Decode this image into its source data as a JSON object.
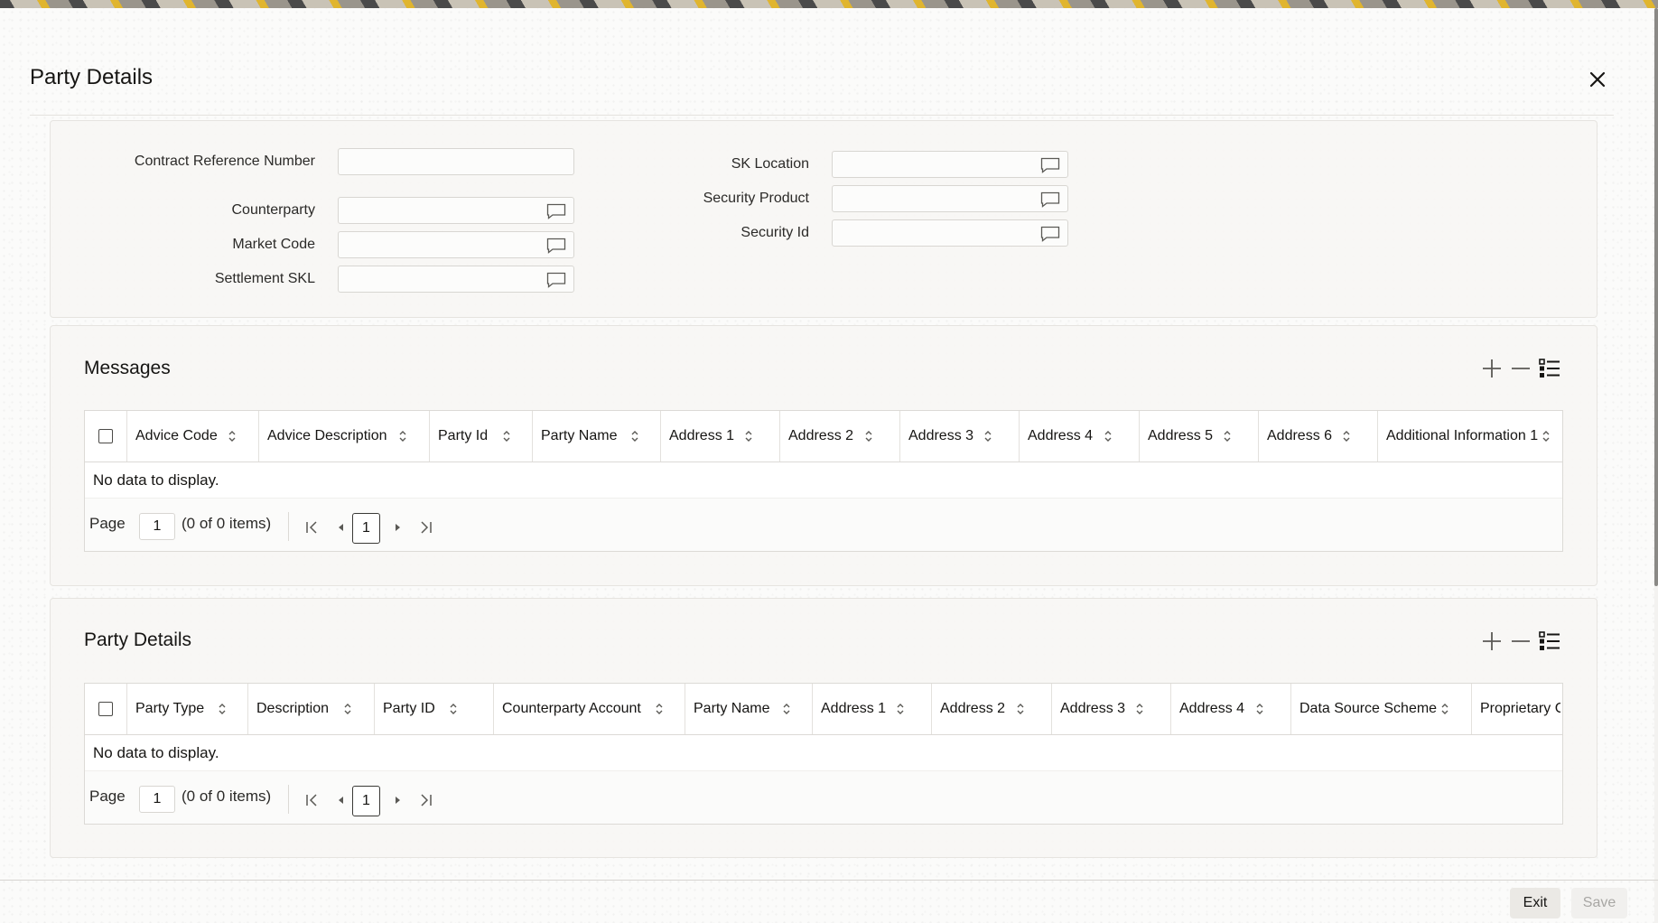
{
  "dialog": {
    "title": "Party Details"
  },
  "form": {
    "contract_reference_number": {
      "label": "Contract Reference Number",
      "value": ""
    },
    "counterparty": {
      "label": "Counterparty",
      "value": ""
    },
    "market_code": {
      "label": "Market Code",
      "value": ""
    },
    "settlement_skl": {
      "label": "Settlement SKL",
      "value": ""
    },
    "sk_location": {
      "label": "SK Location",
      "value": ""
    },
    "security_product": {
      "label": "Security Product",
      "value": ""
    },
    "security_id": {
      "label": "Security Id",
      "value": ""
    }
  },
  "messages": {
    "title": "Messages",
    "columns": [
      "Advice Code",
      "Advice Description",
      "Party Id",
      "Party Name",
      "Address 1",
      "Address 2",
      "Address 3",
      "Address 4",
      "Address 5",
      "Address 6",
      "Additional Information 1"
    ],
    "empty_text": "No data to display.",
    "pager": {
      "page_label": "Page",
      "page_value": "1",
      "items_text": "(0 of 0 items)",
      "current_page": "1"
    }
  },
  "party_details": {
    "title": "Party Details",
    "columns": [
      "Party Type",
      "Description",
      "Party ID",
      "Counterparty Account",
      "Party Name",
      "Address 1",
      "Address 2",
      "Address 3",
      "Address 4",
      "Data Source Scheme",
      "Proprietary C"
    ],
    "empty_text": "No data to display.",
    "pager": {
      "page_label": "Page",
      "page_value": "1",
      "items_text": "(0 of 0 items)",
      "current_page": "1"
    }
  },
  "footer": {
    "exit_label": "Exit",
    "save_label": "Save"
  },
  "icons": {
    "close": "close-icon",
    "lov": "speech-bubble-icon",
    "add": "plus-icon",
    "remove": "minus-icon",
    "columns": "column-list-icon",
    "sort": "sort-arrows-icon",
    "first": "first-page-icon",
    "prev": "previous-page-icon",
    "next": "next-page-icon",
    "last": "last-page-icon"
  },
  "colors": {
    "text": "#161513",
    "disabled_text": "#a8a7a4",
    "panel_bg": "#f7f6f4"
  }
}
